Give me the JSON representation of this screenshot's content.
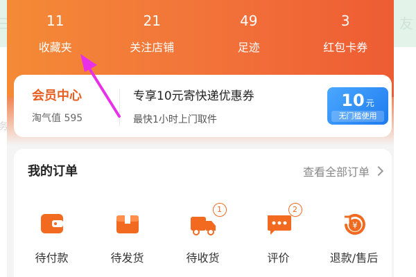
{
  "background": {
    "edge_chars": [
      "三",
      "友",
      "务"
    ]
  },
  "stats": [
    {
      "count": "11",
      "label": "收藏夹"
    },
    {
      "count": "21",
      "label": "关注店铺"
    },
    {
      "count": "49",
      "label": "足迹"
    },
    {
      "count": "3",
      "label": "红包卡券"
    }
  ],
  "member": {
    "title": "会员中心",
    "points": "淘气值 595",
    "promo_title": "专享10元寄快递优惠券",
    "promo_sub": "最快1小时上门取件",
    "coupon_value": "10",
    "coupon_unit": "元",
    "coupon_note": "无门槛使用"
  },
  "orders": {
    "title": "我的订单",
    "view_all": "查看全部订单",
    "items": [
      {
        "label": "待付款",
        "icon": "wallet-icon",
        "badge": ""
      },
      {
        "label": "待发货",
        "icon": "package-icon",
        "badge": ""
      },
      {
        "label": "待收货",
        "icon": "delivery-truck-icon",
        "badge": "1"
      },
      {
        "label": "评价",
        "icon": "comment-icon",
        "badge": "2"
      },
      {
        "label": "退款/售后",
        "icon": "refund-icon",
        "badge": ""
      }
    ]
  },
  "colors": {
    "header_gradient_start": "#f48a36",
    "header_gradient_end": "#ee5c33",
    "member_title": "#e85d1f",
    "coupon_blue": "#1e7bef",
    "icon_orange": "#f26a1f",
    "annotation_arrow": "#e830e8"
  }
}
